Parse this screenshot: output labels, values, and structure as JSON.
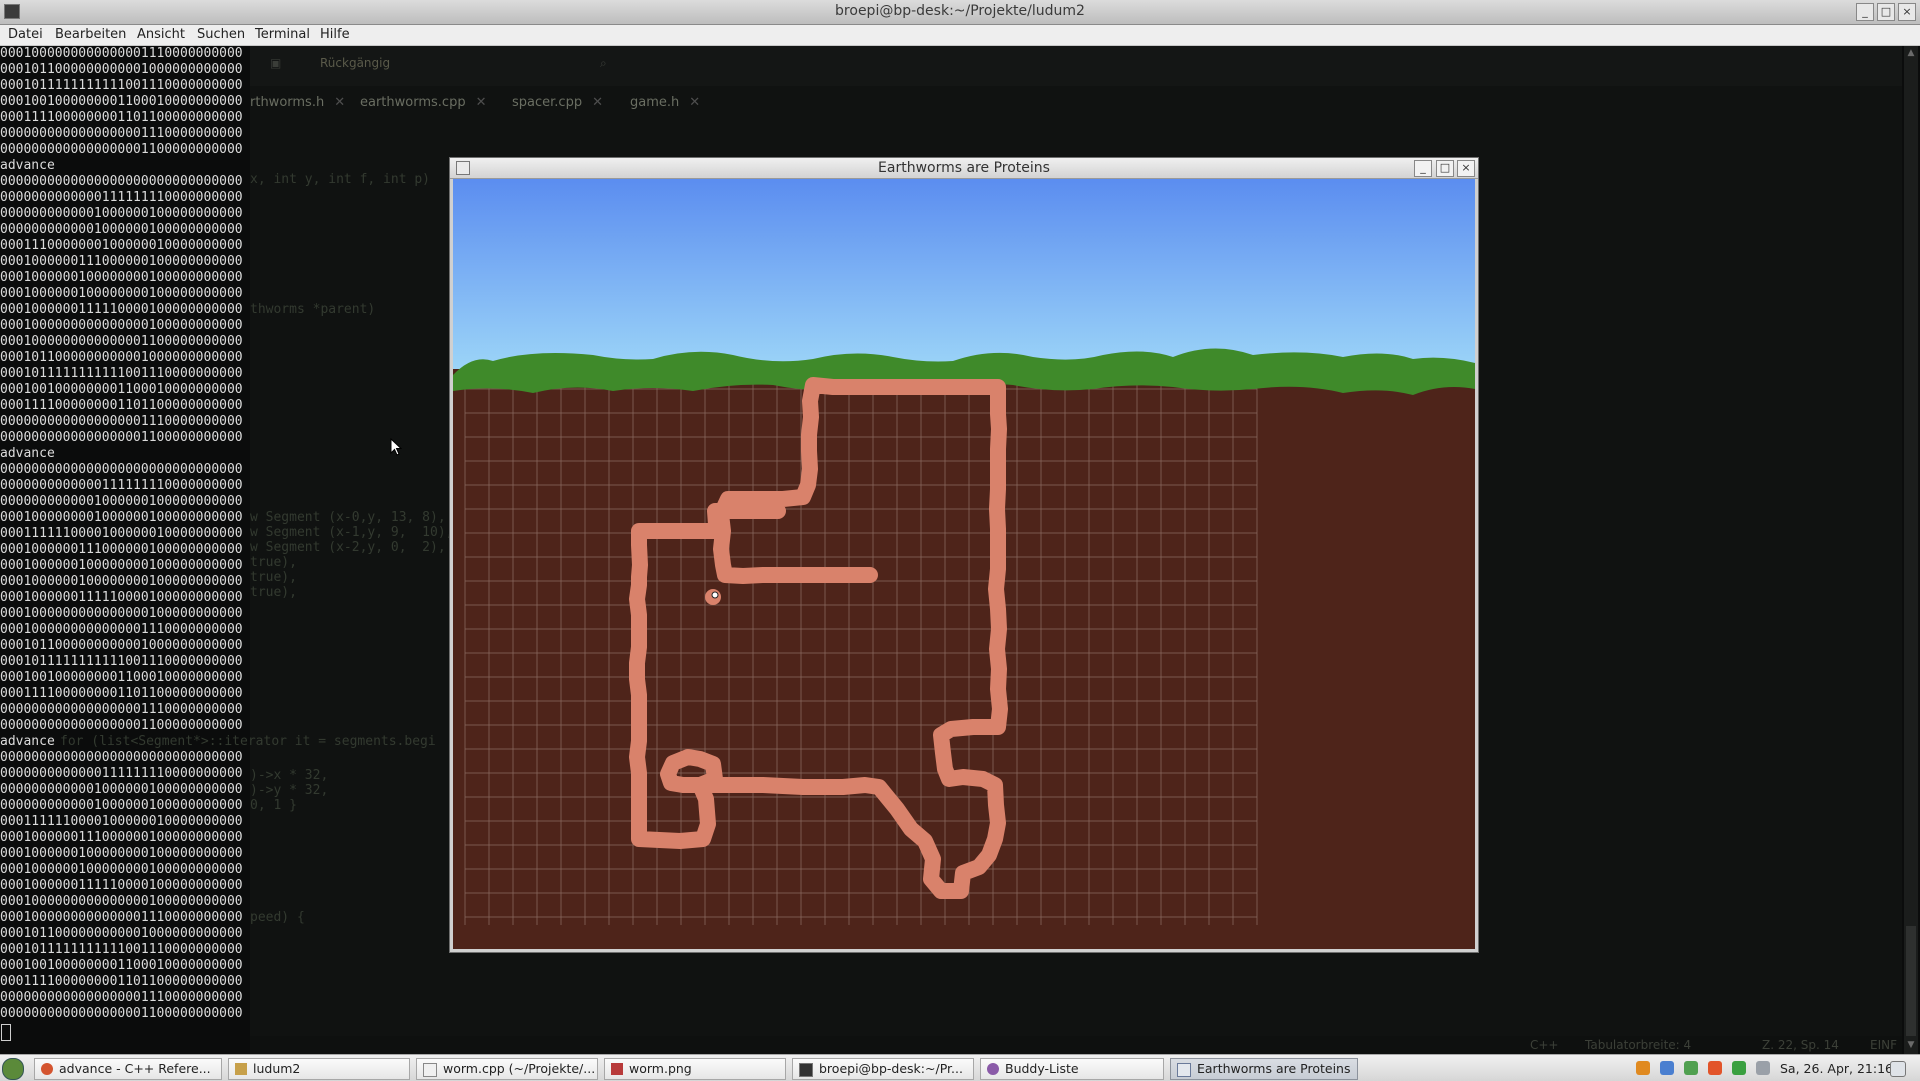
{
  "window": {
    "title": "broepi@bp-desk:~/Projekte/ludum2"
  },
  "menu": [
    "Datei",
    "Bearbeiten",
    "Ansicht",
    "Suchen",
    "Terminal",
    "Hilfe"
  ],
  "editor": {
    "toolbar_undo": "Rückgängig",
    "tabs": [
      "rthworms.h",
      "earthworms.cpp",
      "spacer.cpp",
      "game.h"
    ],
    "status": {
      "language": "C++",
      "tab_width": "Tabulatorbreite: 4",
      "position": "Z. 22, Sp. 14",
      "mode": "EINF"
    }
  },
  "terminal_lines": [
    "0001000000000000001110000000000",
    "0001011000000000001000000000000",
    "0001011111111111001110000000000",
    "0001001000000001100010000000000",
    "0001111000000001101100000000000",
    "0000000000000000001110000000000",
    "0000000000000000001100000000000",
    "advance",
    "0000000000000000000000000000000",
    "0000000000000111111110000000000",
    "0000000000001000000100000000000",
    "0000000000001000000100000000000",
    "0001110000000100000010000000000",
    "0001000000111000000100000000000",
    "0001000000100000000100000000000",
    "0001000000100000000100000000000",
    "0001000000111110000100000000000",
    "0001000000000000000100000000000",
    "0001000000000000001100000000000",
    "0001011000000000001000000000000",
    "0001011111111111001110000000000",
    "0001001000000001100010000000000",
    "0001111000000001101100000000000",
    "0000000000000000001110000000000",
    "0000000000000000001100000000000",
    "advance",
    "0000000000000000000000000000000",
    "0000000000000111111110000000000",
    "0000000000001000000100000000000",
    "0001000000001000000100000000000",
    "0001111110000100000010000000000",
    "0001000000111000000100000000000",
    "0001000000100000000100000000000",
    "0001000000100000000100000000000",
    "0001000000111110000100000000000",
    "0001000000000000000100000000000",
    "0001000000000000001110000000000",
    "0001011000000000001000000000000",
    "0001011111111111001110000000000",
    "0001001000000001100010000000000",
    "0001111000000001101100000000000",
    "0000000000000000001110000000000",
    "0000000000000000001100000000000",
    "advance",
    "0000000000000000000000000000000",
    "0000000000000111111110000000000",
    "0000000000001000000100000000000",
    "0000000000001000000100000000000",
    "0001111110000100000010000000000",
    "0001000000111000000100000000000",
    "0001000000100000000100000000000",
    "0001000000100000000100000000000",
    "0001000000111110000100000000000",
    "0001000000000000000100000000000",
    "0001000000000000001110000000000",
    "0001011000000000001000000000000",
    "0001011111111111001110000000000",
    "0001001000000001100010000000000",
    "0001111000000001101100000000000",
    "0000000000000000001110000000000",
    "0000000000000000001100000000000"
  ],
  "game": {
    "title": "Earthworms are Proteins",
    "colors": {
      "sky_top": "#5b8df0",
      "sky_bottom": "#9fd8f8",
      "grass": "#3f8a2a",
      "soil": "#4e241a",
      "grid": "#8a6a5f",
      "worm": "#d9826b"
    }
  },
  "taskbar": {
    "items": [
      {
        "label": "advance - C++ Refere...",
        "icon": "browser-icon"
      },
      {
        "label": "ludum2",
        "icon": "folder-icon"
      },
      {
        "label": "worm.cpp (~/Projekte/...",
        "icon": "editor-icon"
      },
      {
        "label": "worm.png",
        "icon": "image-icon"
      },
      {
        "label": "broepi@bp-desk:~/Pr...",
        "icon": "terminal-icon"
      },
      {
        "label": "Buddy-Liste",
        "icon": "chat-icon"
      },
      {
        "label": "Earthworms are Proteins",
        "icon": "window-icon",
        "active": true
      }
    ],
    "clock": "Sa, 26. Apr, 21:16"
  }
}
